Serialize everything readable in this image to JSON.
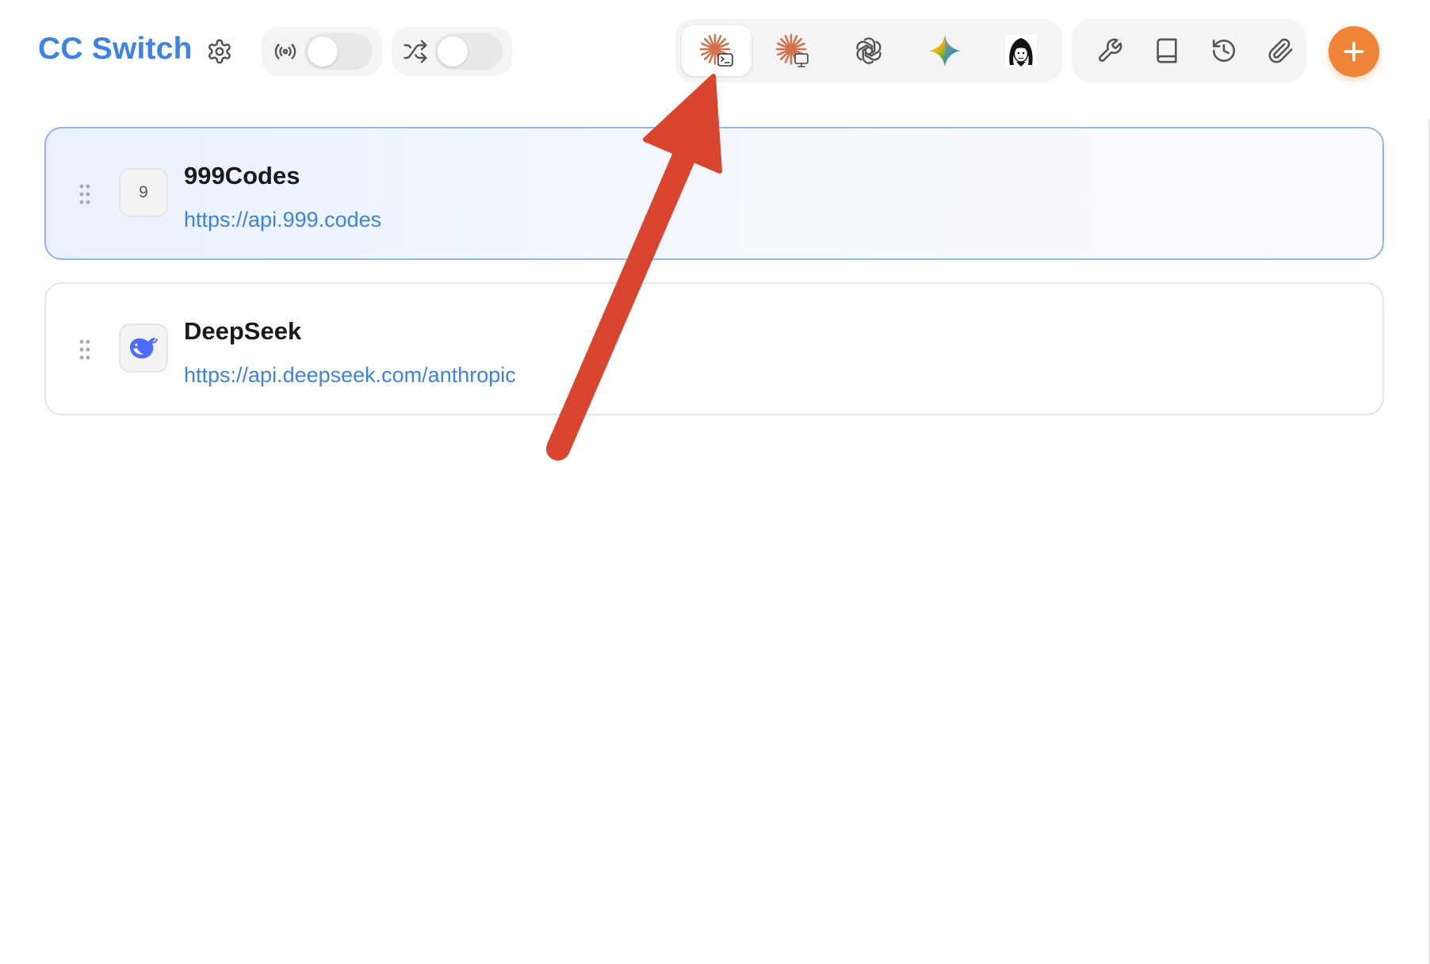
{
  "app": {
    "title": "CC Switch"
  },
  "header": {
    "proxy_toggle": {
      "icon": "radio-broadcast-icon",
      "on": false
    },
    "failover_toggle": {
      "icon": "shuffle-icon",
      "on": false
    },
    "app_tabs": [
      {
        "name": "claude-code",
        "icon": "claude-terminal-icon",
        "active": true
      },
      {
        "name": "claude-desktop",
        "icon": "claude-desktop-icon",
        "active": false
      },
      {
        "name": "codex",
        "icon": "openai-icon",
        "active": false
      },
      {
        "name": "gemini",
        "icon": "gemini-sparkle-icon",
        "active": false
      },
      {
        "name": "opencode",
        "icon": "character-avatar-icon",
        "active": false
      }
    ],
    "tools": [
      {
        "name": "tools",
        "icon": "wrench-icon"
      },
      {
        "name": "prompts",
        "icon": "book-icon"
      },
      {
        "name": "history",
        "icon": "history-icon"
      },
      {
        "name": "attachments",
        "icon": "paperclip-icon"
      }
    ],
    "add_button": {
      "icon": "plus-icon"
    }
  },
  "providers": [
    {
      "name": "999Codes",
      "url": "https://api.999.codes",
      "icon_text": "9",
      "active": true
    },
    {
      "name": "DeepSeek",
      "url": "https://api.deepseek.com/anthropic",
      "icon": "deepseek-whale-icon",
      "active": false
    }
  ],
  "colors": {
    "accent_blue": "#3d82e6",
    "add_orange": "#ef8438",
    "claude_orange": "#d4714e",
    "annotation_red": "#d9452f",
    "active_border": "#8fb7ef"
  }
}
